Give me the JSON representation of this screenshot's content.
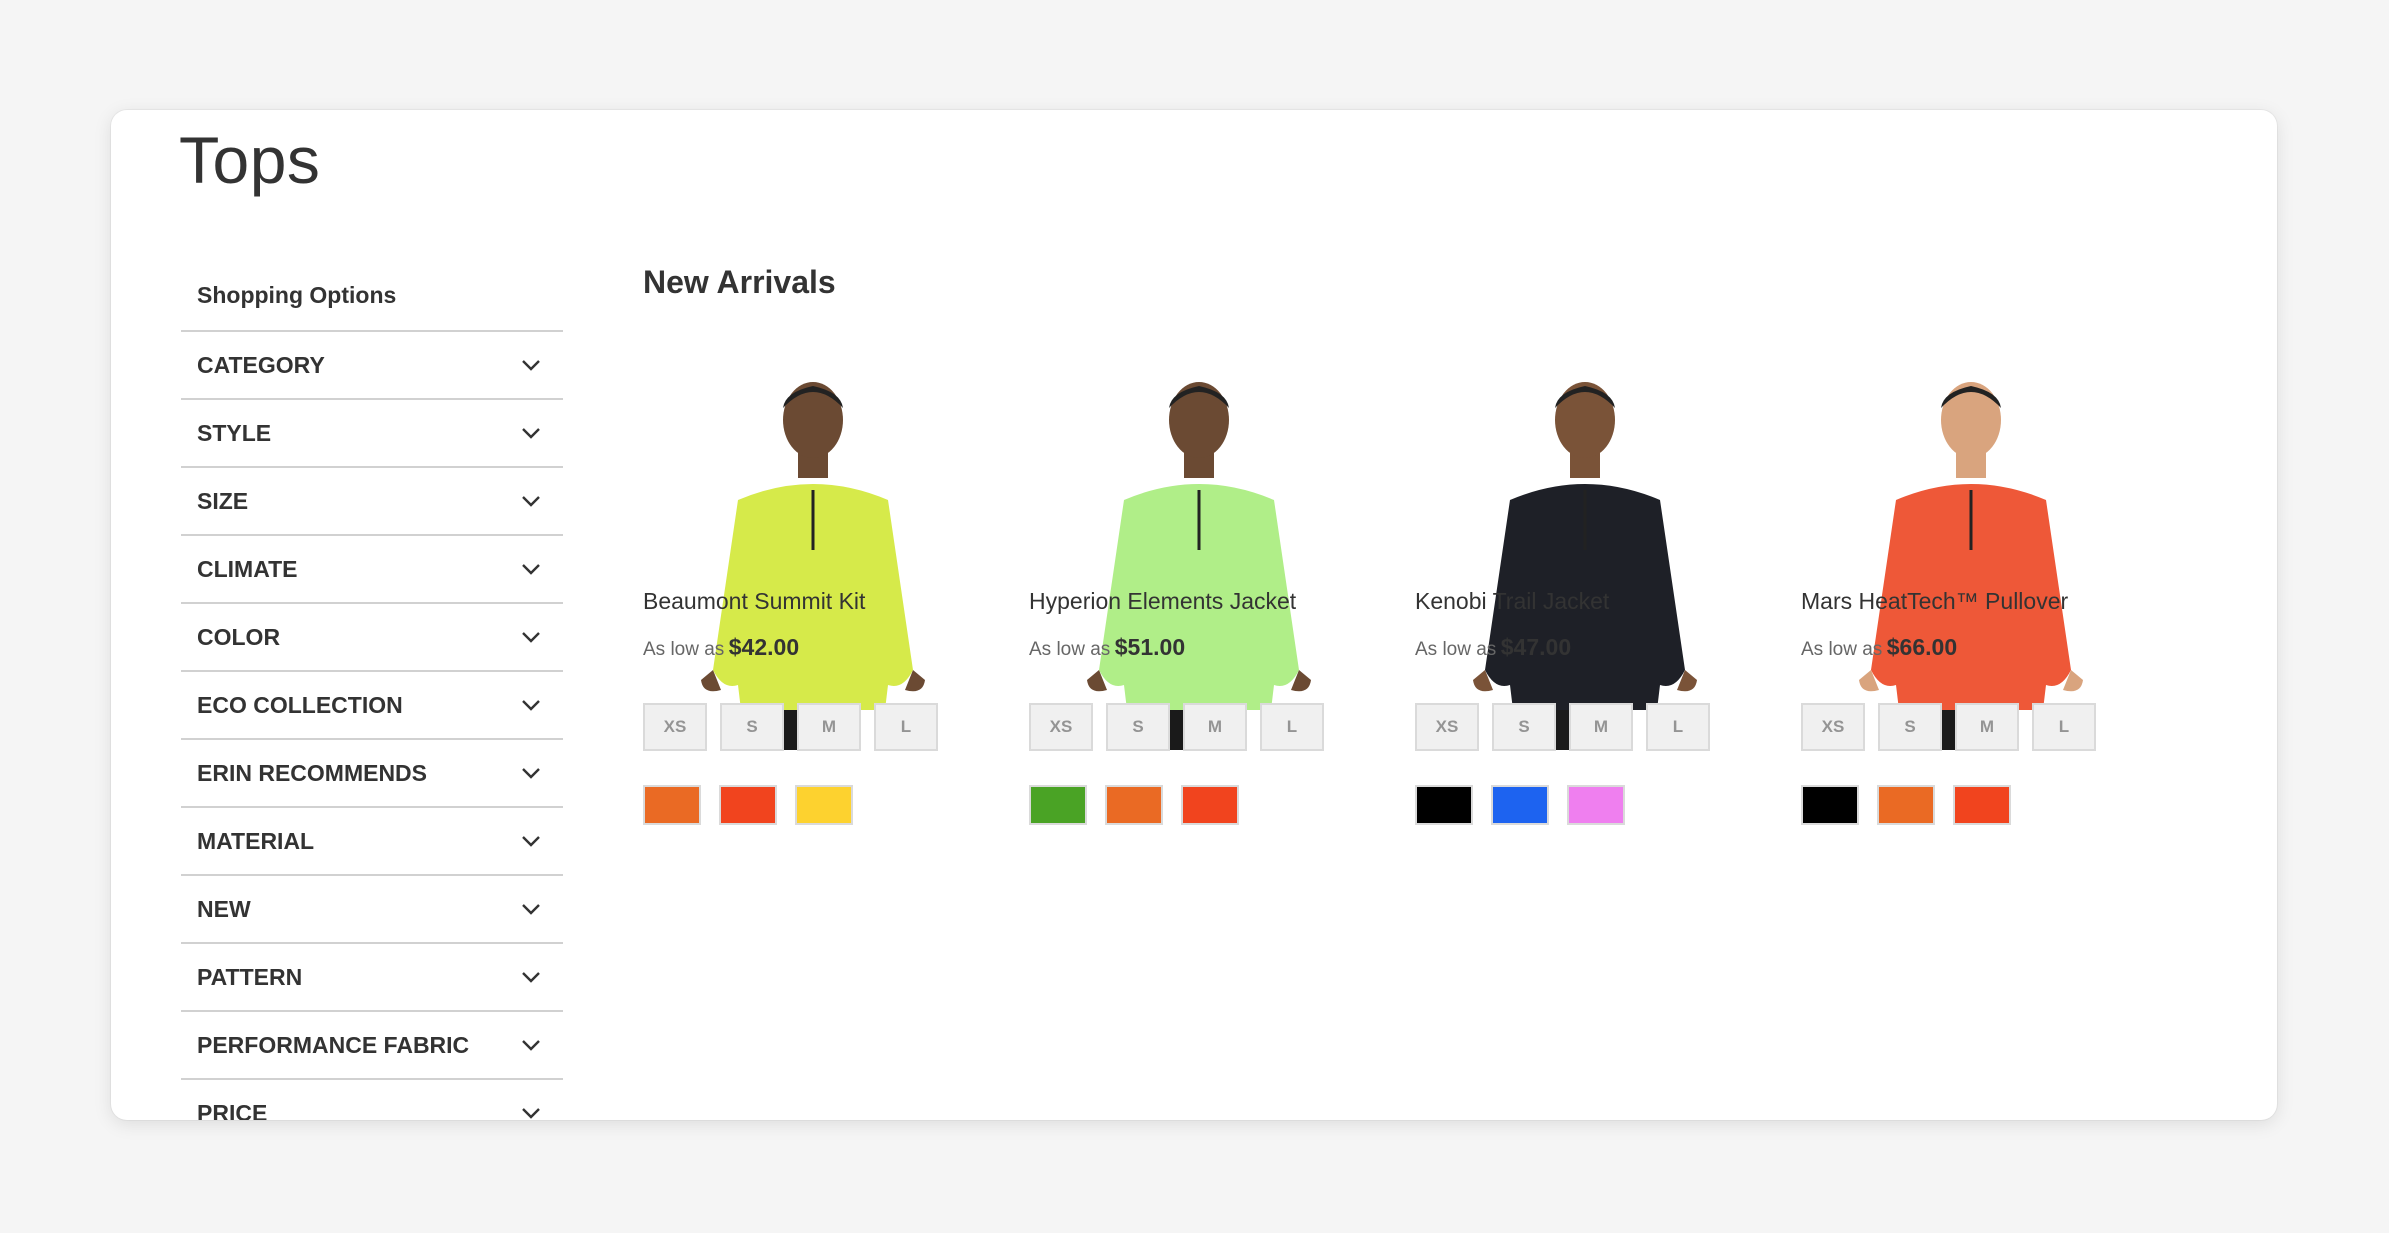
{
  "page": {
    "title": "Tops"
  },
  "sidebar": {
    "title": "Shopping Options",
    "filters": [
      "CATEGORY",
      "STYLE",
      "SIZE",
      "CLIMATE",
      "COLOR",
      "ECO COLLECTION",
      "ERIN RECOMMENDS",
      "MATERIAL",
      "NEW",
      "PATTERN",
      "PERFORMANCE FABRIC",
      "PRICE"
    ]
  },
  "main": {
    "section_title": "New Arrivals",
    "as_low_as": "As low as",
    "products": [
      {
        "name": "Beaumont Summit Kit",
        "price": "$42.00",
        "garment_color": "#d6ea4a",
        "skin": "#6b4a33",
        "sizes": [
          "XS",
          "S",
          "M",
          "L"
        ],
        "swatches": [
          "#ea6a24",
          "#f1441e",
          "#fdd22f"
        ]
      },
      {
        "name": "Hyperion Elements Jacket",
        "price": "$51.00",
        "garment_color": "#b0ee88",
        "skin": "#6b4a33",
        "sizes": [
          "XS",
          "S",
          "M",
          "L"
        ],
        "swatches": [
          "#4aa325",
          "#ea6a24",
          "#f1441e"
        ]
      },
      {
        "name": "Kenobi Trail Jacket",
        "price": "$47.00",
        "garment_color": "#1e2027",
        "skin": "#7a5338",
        "sizes": [
          "XS",
          "S",
          "M",
          "L"
        ],
        "swatches": [
          "#000000",
          "#1d63f0",
          "#ef7fef"
        ]
      },
      {
        "name": "Mars HeatTech™ Pullover",
        "price": "$66.00",
        "garment_color": "#ee5838",
        "skin": "#d9a47e",
        "sizes": [
          "XS",
          "S",
          "M",
          "L"
        ],
        "swatches": [
          "#000000",
          "#ea6a24",
          "#f1441e"
        ]
      }
    ]
  }
}
